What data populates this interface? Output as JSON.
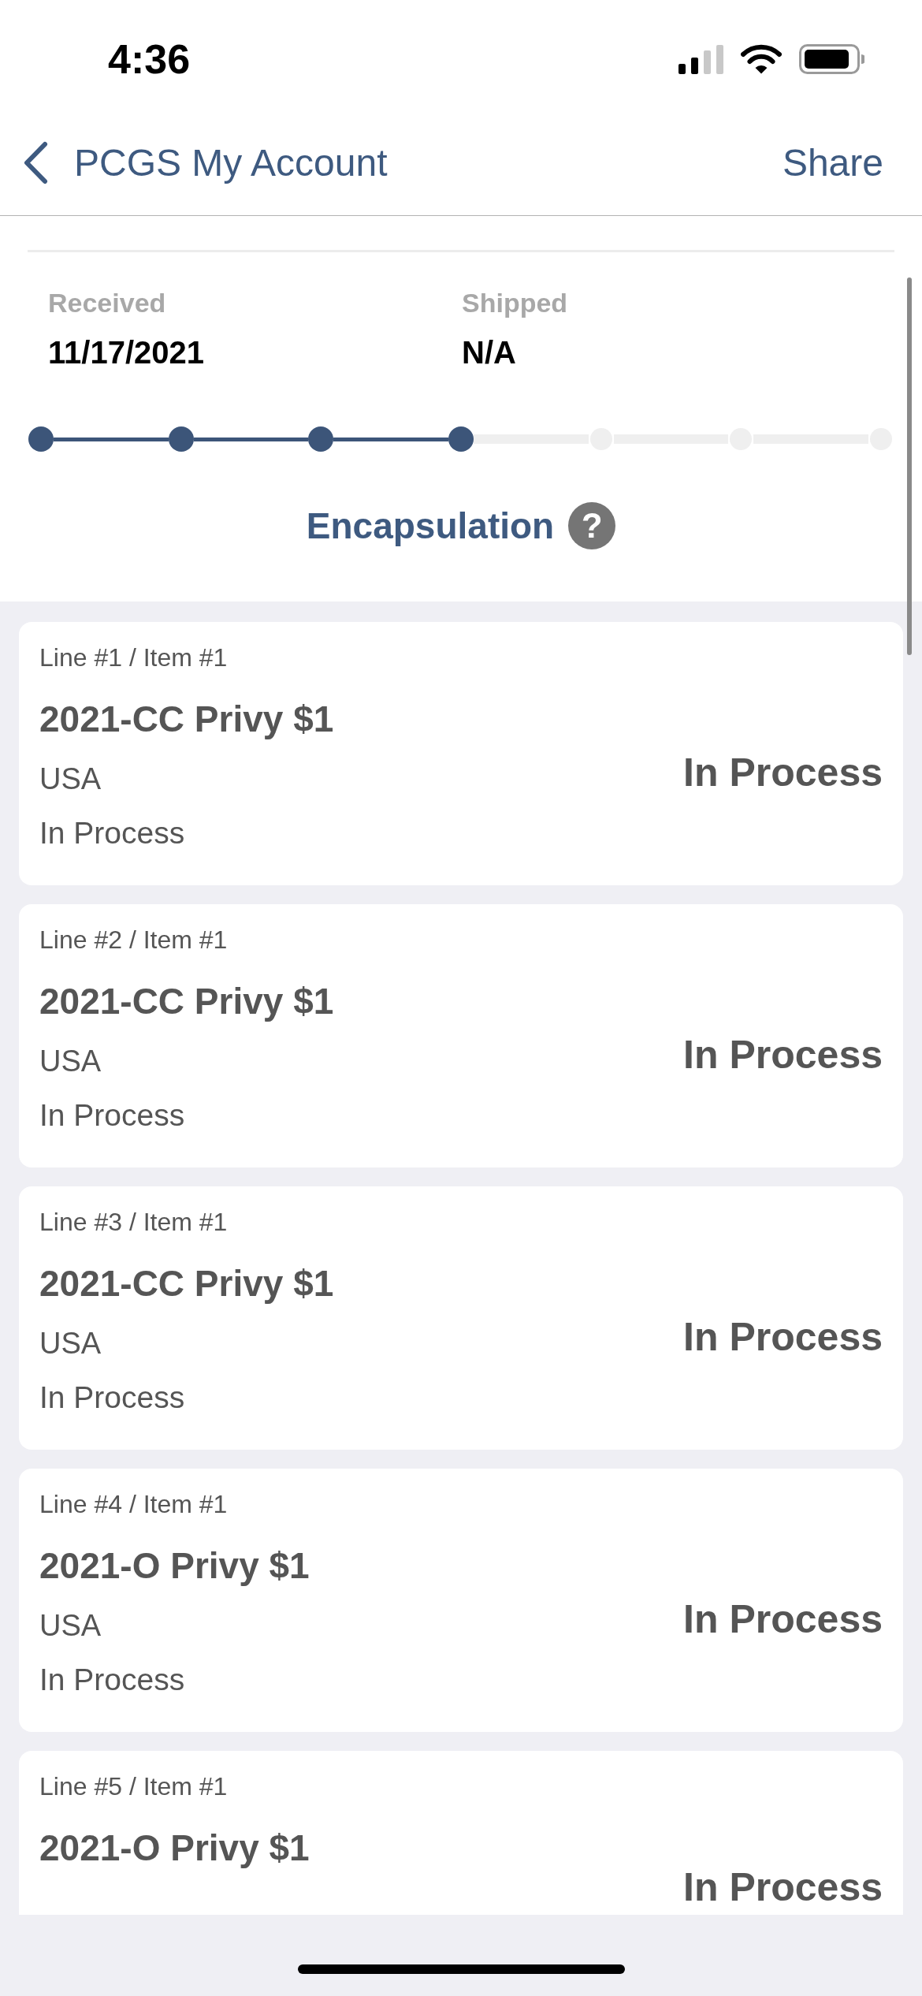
{
  "status_bar": {
    "time": "4:36"
  },
  "nav": {
    "back_label": "PCGS My Account",
    "action": "Share"
  },
  "order": {
    "fields": [
      {
        "label": "Received",
        "value": "11/17/2021"
      },
      {
        "label": "Shipped",
        "value": "N/A"
      }
    ],
    "timeline": {
      "steps": [
        {
          "completed": true
        },
        {
          "completed": true
        },
        {
          "completed": true
        },
        {
          "completed": true
        },
        {
          "completed": false
        },
        {
          "completed": false
        },
        {
          "completed": false
        }
      ]
    },
    "stage": "Encapsulation",
    "help_glyph": "?"
  },
  "items": [
    {
      "line_label": "Line #1 / Item #1",
      "title": "2021-CC Privy $1",
      "country": "USA",
      "substatus": "In Process",
      "status": "In Process"
    },
    {
      "line_label": "Line #2 / Item #1",
      "title": "2021-CC Privy $1",
      "country": "USA",
      "substatus": "In Process",
      "status": "In Process"
    },
    {
      "line_label": "Line #3 / Item #1",
      "title": "2021-CC Privy $1",
      "country": "USA",
      "substatus": "In Process",
      "status": "In Process"
    },
    {
      "line_label": "Line #4 / Item #1",
      "title": "2021-O Privy $1",
      "country": "USA",
      "substatus": "In Process",
      "status": "In Process"
    },
    {
      "line_label": "Line #5 / Item #1",
      "title": "2021-O Privy $1",
      "status": "In Process"
    }
  ]
}
